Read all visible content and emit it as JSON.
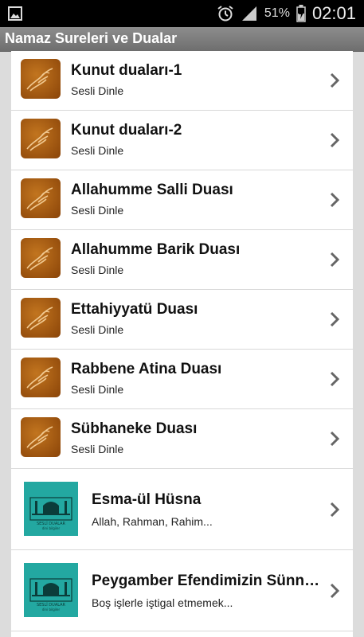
{
  "status_bar": {
    "battery_percent": "51%",
    "time": "02:01"
  },
  "app_bar": {
    "title": "Namaz Sureleri ve Dualar"
  },
  "items": [
    {
      "title": "Kunut duaları-1",
      "subtitle": "Sesli Dinle",
      "icon": "praying-hands-icon"
    },
    {
      "title": "Kunut duaları-2",
      "subtitle": "Sesli Dinle",
      "icon": "praying-hands-icon"
    },
    {
      "title": "Allahumme Salli Duası",
      "subtitle": "Sesli Dinle",
      "icon": "praying-hands-icon"
    },
    {
      "title": "Allahumme Barik Duası",
      "subtitle": "Sesli Dinle",
      "icon": "praying-hands-icon"
    },
    {
      "title": "Ettahiyyatü Duası",
      "subtitle": "Sesli Dinle",
      "icon": "praying-hands-icon"
    },
    {
      "title": "Rabbene Atina Duası",
      "subtitle": "Sesli Dinle",
      "icon": "praying-hands-icon"
    },
    {
      "title": "Sübhaneke Duası",
      "subtitle": "Sesli Dinle",
      "icon": "praying-hands-icon"
    },
    {
      "title": "Esma-ül Hüsna",
      "subtitle": "Allah, Rahman, Rahim...",
      "icon": "sesli-dualar-logo-icon"
    },
    {
      "title": "Peygamber Efendimizin Sünnetleri",
      "subtitle": "Boş işlerle iştigal etmemek...",
      "icon": "sesli-dualar-logo-icon"
    }
  ],
  "logo_text": {
    "line1": "SESLİ DUALAR",
    "line2": "dini bilgiler"
  },
  "colors": {
    "status_bar": "#000000",
    "app_bar": "#7a7a7a",
    "list_bg": "#ffffff",
    "thumb_orange": "#a85a12",
    "thumb_teal": "#23a8a1",
    "chevron": "#666666"
  }
}
